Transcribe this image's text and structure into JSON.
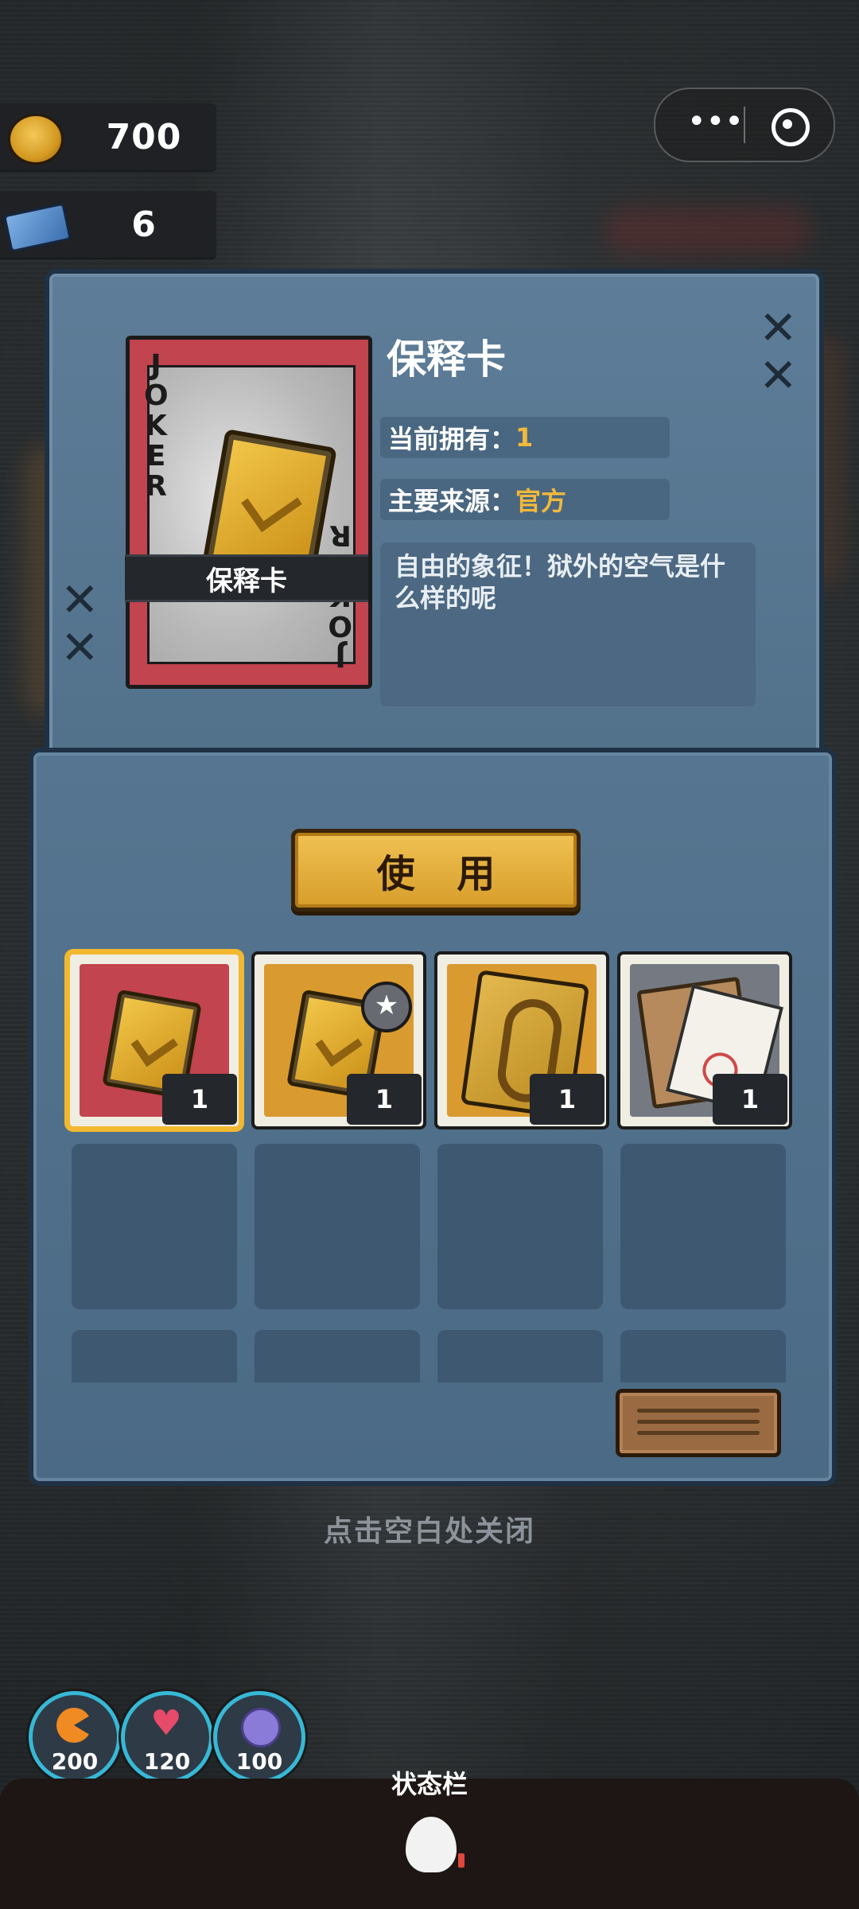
{
  "currency": {
    "coins": "700",
    "tickets": "6"
  },
  "capsule": {
    "more_icon": "more-dots-icon",
    "target_icon": "target-icon"
  },
  "item": {
    "title": "保释卡",
    "card_label": "保释卡",
    "card_corner_text": "JOKER",
    "owned_label": "当前拥有：",
    "owned_value": "1",
    "source_label": "主要来源：",
    "source_value": "官方",
    "description": "自由的象征！狱外的空气是什么样的呢"
  },
  "use_button": "使 用",
  "inventory": [
    {
      "name": "bail-card",
      "count": "1",
      "bg": "#c1444f",
      "selected": true
    },
    {
      "name": "bail-card-plus",
      "count": "1",
      "bg": "#d99a2f",
      "selected": false
    },
    {
      "name": "rope-card",
      "count": "1",
      "bg": "#d99a2f",
      "selected": false
    },
    {
      "name": "document-envelope",
      "count": "1",
      "bg": "#757a82",
      "selected": false
    }
  ],
  "close_hint": "点击空白处关闭",
  "stats": [
    {
      "name": "hunger",
      "value": "200",
      "color": "#f08a22"
    },
    {
      "name": "health",
      "value": "120",
      "color": "#e84a6a"
    },
    {
      "name": "brain",
      "value": "100",
      "color": "#8a7bd8"
    }
  ],
  "status_bar_title": "状态栏",
  "colors": {
    "panel": "#52718b",
    "accent_gold": "#f1b830",
    "stat_ring": "#37b8d6"
  }
}
